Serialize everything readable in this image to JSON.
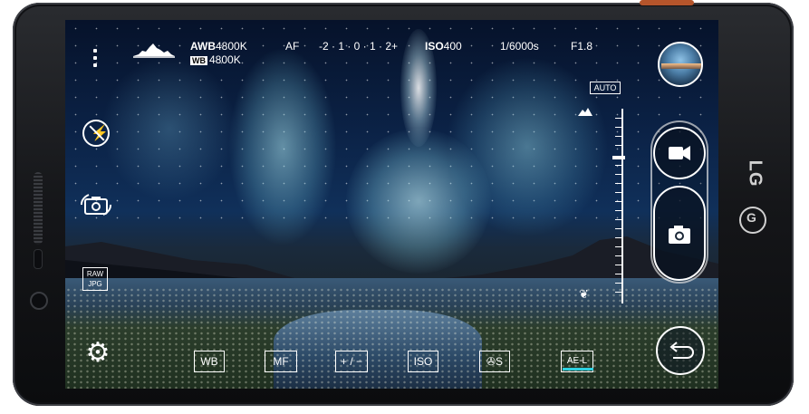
{
  "topbar": {
    "awb_label": "AWB",
    "awb_value": "4800K",
    "wb_badge": "WB",
    "wb_value": "4800K",
    "af_label": "AF",
    "ev_scale": "-2 · 1 · 0 · 1 · 2+",
    "iso_label": "ISO",
    "iso_value": "400",
    "shutter": "1/6000s",
    "aperture": "F1.8"
  },
  "left": {
    "raw_label": "RAW",
    "jpg_label": "JPG"
  },
  "bottom": {
    "wb": "WB",
    "mf": "MF",
    "ev": "+ / −",
    "iso": "ISO",
    "shutter_speed": "S",
    "ael": "AE-L"
  },
  "right": {
    "focus_auto_label": "AUTO"
  },
  "brand": {
    "logo_text": "LG"
  },
  "colors": {
    "accent": "#2ed1e0",
    "bezel": "#1a1b1e",
    "copper_trim": "#b5552b"
  },
  "icons": {
    "menu": "more-vertical-icon",
    "histogram": "histogram-icon",
    "flash": "flash-off-icon",
    "switch_camera": "switch-camera-icon",
    "settings": "gear-icon",
    "gallery": "gallery-thumbnail",
    "video": "video-camera-icon",
    "photo": "camera-icon",
    "back": "back-icon",
    "landscape": "mountain-icon",
    "macro": "tulip-icon"
  }
}
